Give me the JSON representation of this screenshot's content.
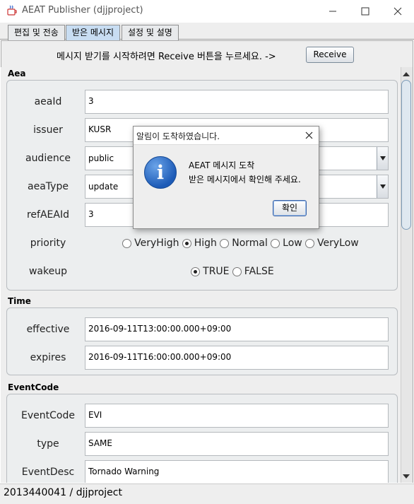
{
  "window": {
    "title": "AEAT Publisher (djjproject)"
  },
  "tabs": [
    {
      "label": "편집 및 전송"
    },
    {
      "label": "받은 메시지"
    },
    {
      "label": "설정 및 설명"
    }
  ],
  "receive": {
    "message": "메시지 받기를 시작하려면 Receive 버튼을 누르세요. ->",
    "button_label": "Receive"
  },
  "aea": {
    "section_label": "Aea",
    "fields": {
      "aeaId": {
        "label": "aeaId",
        "value": "3"
      },
      "issuer": {
        "label": "issuer",
        "value": "KUSR"
      },
      "audience": {
        "label": "audience",
        "value": "public"
      },
      "aeaType": {
        "label": "aeaType",
        "value": "update"
      },
      "refAEAId": {
        "label": "refAEAId",
        "value": "3"
      }
    },
    "priority": {
      "label": "priority",
      "options": [
        "VeryHigh",
        "High",
        "Normal",
        "Low",
        "VeryLow"
      ],
      "selected": "High"
    },
    "wakeup": {
      "label": "wakeup",
      "options": [
        "TRUE",
        "FALSE"
      ],
      "selected": "TRUE"
    }
  },
  "time": {
    "section_label": "Time",
    "effective": {
      "label": "effective",
      "value": "2016-09-11T13:00:00.000+09:00"
    },
    "expires": {
      "label": "expires",
      "value": "2016-09-11T16:00:00.000+09:00"
    }
  },
  "eventcode": {
    "section_label": "EventCode",
    "code": {
      "label": "EventCode",
      "value": "EVI"
    },
    "type": {
      "label": "type",
      "value": "SAME"
    },
    "desc": {
      "label": "EventDesc",
      "value": "Tornado Warning"
    }
  },
  "status": {
    "text": "2013440041 / djjproject"
  },
  "dialog": {
    "title": "알림이 도착하였습니다.",
    "line1": "AEAT 메시지 도착",
    "line2": "받은 메시지에서 확인해 주세요.",
    "ok_label": "확인",
    "icon": "info-icon"
  },
  "colors": {
    "accent": "#c8ddf2",
    "panel": "#eeeeee"
  }
}
